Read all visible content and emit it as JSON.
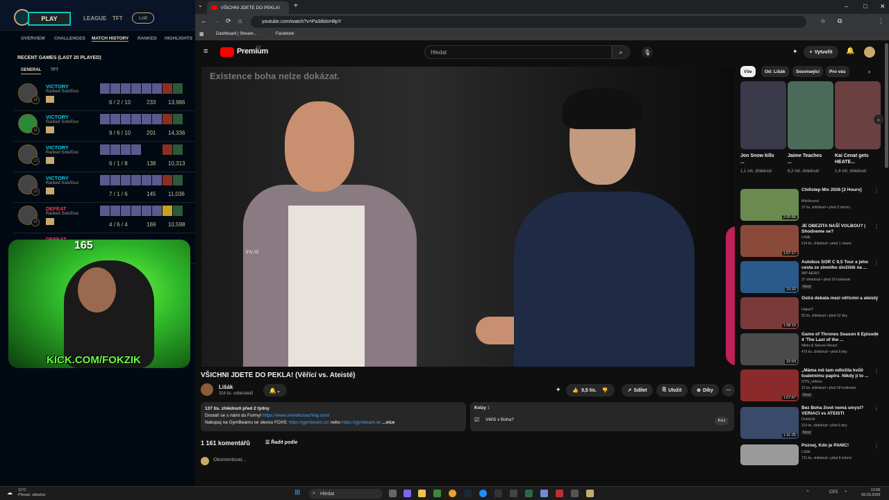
{
  "lol": {
    "play": "PLAY",
    "nav": [
      "LEAGUE",
      "TFT"
    ],
    "badge": "Lo8",
    "subnav": [
      "OVERVIEW",
      "CHALLENGES",
      "MATCH HISTORY",
      "RANKED",
      "HIGHLIGHTS"
    ],
    "recent_title": "RECENT GAMES (LAST 20 PLAYED)",
    "tabs": [
      "GENERAL",
      "TFT"
    ],
    "games": [
      {
        "result": "VICTORY",
        "queue": "Ranked Solo/Duo",
        "level": "18",
        "kda": "6 / 2 / 10",
        "cs": "233",
        "gold": "13,986"
      },
      {
        "result": "VICTORY",
        "queue": "Ranked Solo/Duo",
        "level": "16",
        "kda": "9 / 6 / 10",
        "cs": "201",
        "gold": "14,336"
      },
      {
        "result": "VICTORY",
        "queue": "Ranked Solo/Duo",
        "level": "13",
        "kda": "6 / 1 / 8",
        "cs": "138",
        "gold": "10,313"
      },
      {
        "result": "VICTORY",
        "queue": "Ranked Solo/Duo",
        "level": "15",
        "kda": "7 / 1 / 6",
        "cs": "145",
        "gold": "11,036"
      },
      {
        "result": "DEFEAT",
        "queue": "Ranked Solo/Duo",
        "level": "15",
        "kda": "4 / 6 / 4",
        "cs": "169",
        "gold": "10,598"
      },
      {
        "result": "DEFEAT",
        "queue": "",
        "level": "",
        "kda": "",
        "cs": "",
        "gold": ""
      }
    ]
  },
  "cam": {
    "url": "KICK.COM/FOKZIK",
    "count": "165"
  },
  "browser": {
    "tab_title": "VŠICHNI JDETE DO PEKLA!",
    "url": "youtube.com/watch?v=Pa3i8dvH8pY",
    "bookmarks": [
      "Dashboard | Stream...",
      "Facebook"
    ]
  },
  "yt": {
    "brand": "Premium",
    "region": "CZ",
    "search_placeholder": "Hledat",
    "create": "Vytvořit",
    "video_subtitle": "Existence boha nelze dokázat.",
    "video_watermark": "inv.st",
    "title": "VŠICHNI JDETE DO PEKLA! (Věřící vs. Ateisté)",
    "channel": "Lišák",
    "subs": "324 tis. odběratelů",
    "likes": "5,5 tis.",
    "share": "Sdílet",
    "save": "Uložit",
    "thanks": "Díky",
    "desc_line1": "137 tis. zhlédnutí  před 2 týdny",
    "desc_line2a": "Dostaň se s námi do Formy!",
    "desc_link1": "https://www.shreditcoaching.com/",
    "desc_line3a": "Nakupuj na GymBeamu se slevou FOX5:",
    "desc_link2": "https://gymbeam.cz/",
    "desc_or": "nebo",
    "desc_link3": "https://gymbeam.sk",
    "desc_more": "...více",
    "quiz_label": "Kvízy",
    "quiz_count": "1",
    "quiz_q": "Věříš v Boha?",
    "quiz_btn": "Kvíz",
    "comments": "1 161 komentářů",
    "sort": "Řadit podle",
    "add_comment": "Okomentovat..."
  },
  "sidebar": {
    "chips": [
      "Vše",
      "Od: Lišák",
      "Související",
      "Pro vás"
    ],
    "shorts": [
      {
        "title": "Jon Snow kills ...",
        "views": "1,1 mil. zhlédnutí",
        "color": "#3a3a4a"
      },
      {
        "title": "Jaime Teaches ...",
        "views": "6,2 mil. zhlédnutí",
        "color": "#4a6a5a"
      },
      {
        "title": "Kai Cenat gets HEATE...",
        "views": "1,4 mil. zhlédnutí",
        "color": "#6a4040"
      }
    ],
    "recs": [
      {
        "title": "Chillstep Mix 2026 [2 Hours]",
        "channel": "MixHound",
        "meta": "37 tis. zhlédnutí • před 2 měsíci",
        "dur": "2:00:56",
        "new": "",
        "color": "#6a8a50"
      },
      {
        "title": "JE OBEZITA NAŠÍ VOLBOU? | Shodneme se?",
        "channel": "Lišák",
        "meta": "514 tis. zhlédnutí • před 1 rokem",
        "dur": "1:07:17",
        "new": "",
        "color": "#8a4a3a"
      },
      {
        "title": "Autobus SOR C 9,5 Tour a jeho cesta ze zimního úložiště na ...",
        "channel": "WP AERO",
        "meta": "37 zhlédnutí • před 16 hodinami",
        "dur": "23:32",
        "new": "Nový",
        "color": "#2a5a8a"
      },
      {
        "title": "Ostrá debata mezi věřícími a ateisty",
        "channel": "HaiseT",
        "meta": "52 tis. zhlédnutí • před 12 dny",
        "dur": "1:58:19",
        "new": "",
        "color": "#7a3a3a"
      },
      {
        "title": "Game of Thrones Season 8 Episode 4 'The Last of the ...",
        "channel": "Nikki & Steven React",
        "meta": "479 tis. zhlédnutí • před 6 lety",
        "dur": "22:03",
        "new": "",
        "color": "#4a4a4a"
      },
      {
        "title": "„Máma mě tam odložila kvůli toaletnímu papíru. Nikdy jí to ...",
        "channel": "STN_videos",
        "meta": "22 tis. zhlédnutí • před 18 hodinami",
        "dur": "1:07:57",
        "new": "Nový",
        "color": "#8a2a2a"
      },
      {
        "title": "Bez Boha život nemá smysl? VERIACI vs ATEISTI",
        "channel": "Duklock",
        "meta": "119 tis. zhlédnutí • před 6 dny",
        "dur": "1:31:25",
        "new": "Nový",
        "color": "#3a4a6a"
      },
      {
        "title": "Poznej, Kdo je PANIC!",
        "channel": "Lišák",
        "meta": "721 tis. zhlédnutí • před 8 měsíci",
        "dur": "",
        "new": "",
        "color": "#9a9a9a"
      }
    ]
  },
  "taskbar": {
    "temp": "11°C",
    "weather": "Převaž. oblačno",
    "search": "Hledat",
    "lang": "CES",
    "time": "12:56",
    "date": "09.03.2026"
  },
  "colors": {
    "victory": "#0acbe6",
    "defeat": "#e84057",
    "yt_red": "#ff0000",
    "link": "#3ea6ff"
  }
}
